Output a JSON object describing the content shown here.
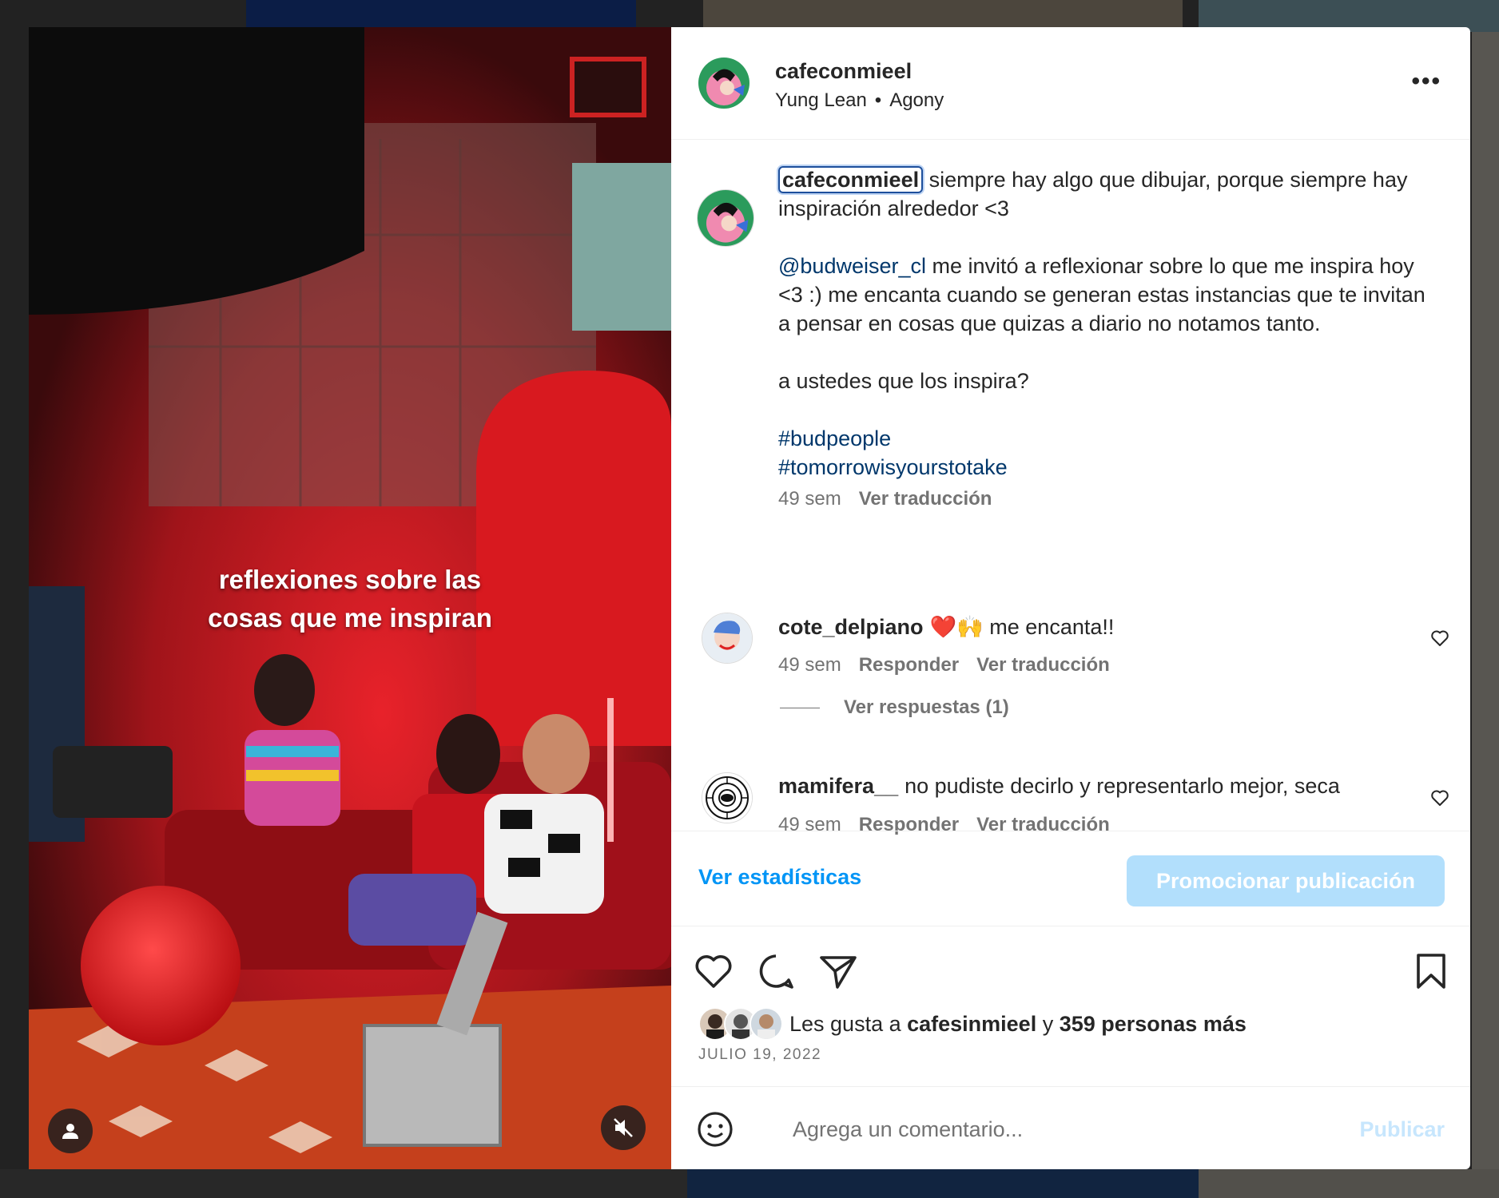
{
  "media": {
    "caption_line1": "reflexiones sobre las",
    "caption_line2": "cosas que me inspiran",
    "user_tag_icon": "person-icon",
    "mute_icon": "speaker-muted-icon"
  },
  "header": {
    "username": "cafeconmieel",
    "artist": "Yung Lean",
    "song": "Agony",
    "separator": "•",
    "more_label": "•••"
  },
  "caption": {
    "username": "cafeconmieel",
    "line1": " siempre hay algo que dibujar, porque siempre hay inspiración alrededor <3",
    "mention": "@budweiser_cl",
    "para2": " me invitó a reflexionar sobre lo que me inspira hoy <3 :) me encanta cuando se generan estas instancias que te invitan a pensar en cosas que quizas a diario no notamos tanto.",
    "para3": "a ustedes que los inspira?",
    "hashtag1": "#budpeople",
    "hashtag2": "#tomorrowisyourstotake",
    "time": "49 sem",
    "translate": "Ver traducción"
  },
  "comments": [
    {
      "username": "cote_delpiano",
      "text": "❤️🙌 me encanta!!",
      "time": "49 sem",
      "reply": "Responder",
      "translate": "Ver traducción"
    },
    {
      "username": "mamifera__",
      "text": "no pudiste decirlo y representarlo mejor, seca",
      "time": "49 sem",
      "reply": "Responder",
      "translate": "Ver traducción"
    }
  ],
  "replies_label": "Ver respuestas (1)",
  "stats": {
    "view_insights": "Ver estadísticas",
    "promote": "Promocionar publicación"
  },
  "likes": {
    "prefix": "Les gusta a ",
    "user": "cafesinmieel",
    "conj": " y ",
    "count": "359 personas más"
  },
  "date": "JULIO 19, 2022",
  "add_comment": {
    "placeholder": "Agrega un comentario...",
    "post": "Publicar"
  },
  "colors": {
    "link": "#00376b",
    "accent": "#0095f6",
    "promo_bg": "#b2dffc",
    "secondary_text": "#737373"
  }
}
